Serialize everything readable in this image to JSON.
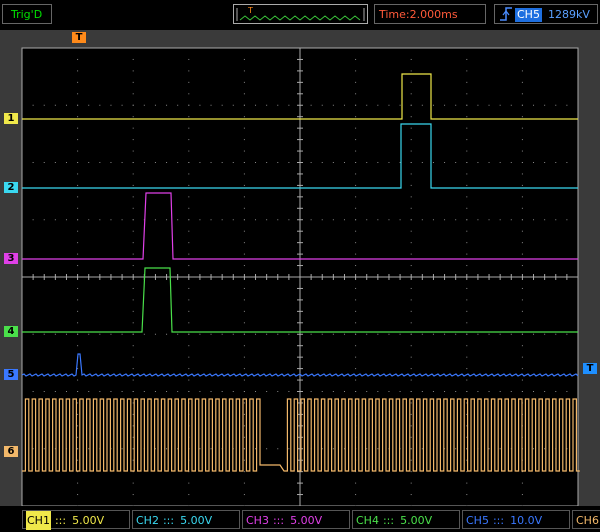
{
  "status": {
    "trig_state": "Trig'D"
  },
  "trigger_position": {
    "marker": "T"
  },
  "timebase": {
    "label": "Time:",
    "value": "2.000ms"
  },
  "trigger": {
    "source": "CH5",
    "level": "1289kV",
    "edge_icon": "rising-edge-icon"
  },
  "markers": {
    "trigger_top": "T",
    "trigger_level": "T"
  },
  "channels": [
    {
      "id": "1",
      "name": "CH1",
      "coupling": ":::",
      "scale": "5.00V",
      "color": "#f0e84a"
    },
    {
      "id": "2",
      "name": "CH2",
      "coupling": ":::",
      "scale": "5.00V",
      "color": "#3ad8f0"
    },
    {
      "id": "3",
      "name": "CH3",
      "coupling": ":::",
      "scale": "5.00V",
      "color": "#e040e8"
    },
    {
      "id": "4",
      "name": "CH4",
      "coupling": ":::",
      "scale": "5.00V",
      "color": "#4ae04a"
    },
    {
      "id": "5",
      "name": "CH5",
      "coupling": ":::",
      "scale": "10.0V",
      "color": "#3a78ff"
    },
    {
      "id": "6",
      "name": "CH6",
      "coupling": "",
      "scale": "",
      "color": "#f2b86a"
    }
  ]
}
